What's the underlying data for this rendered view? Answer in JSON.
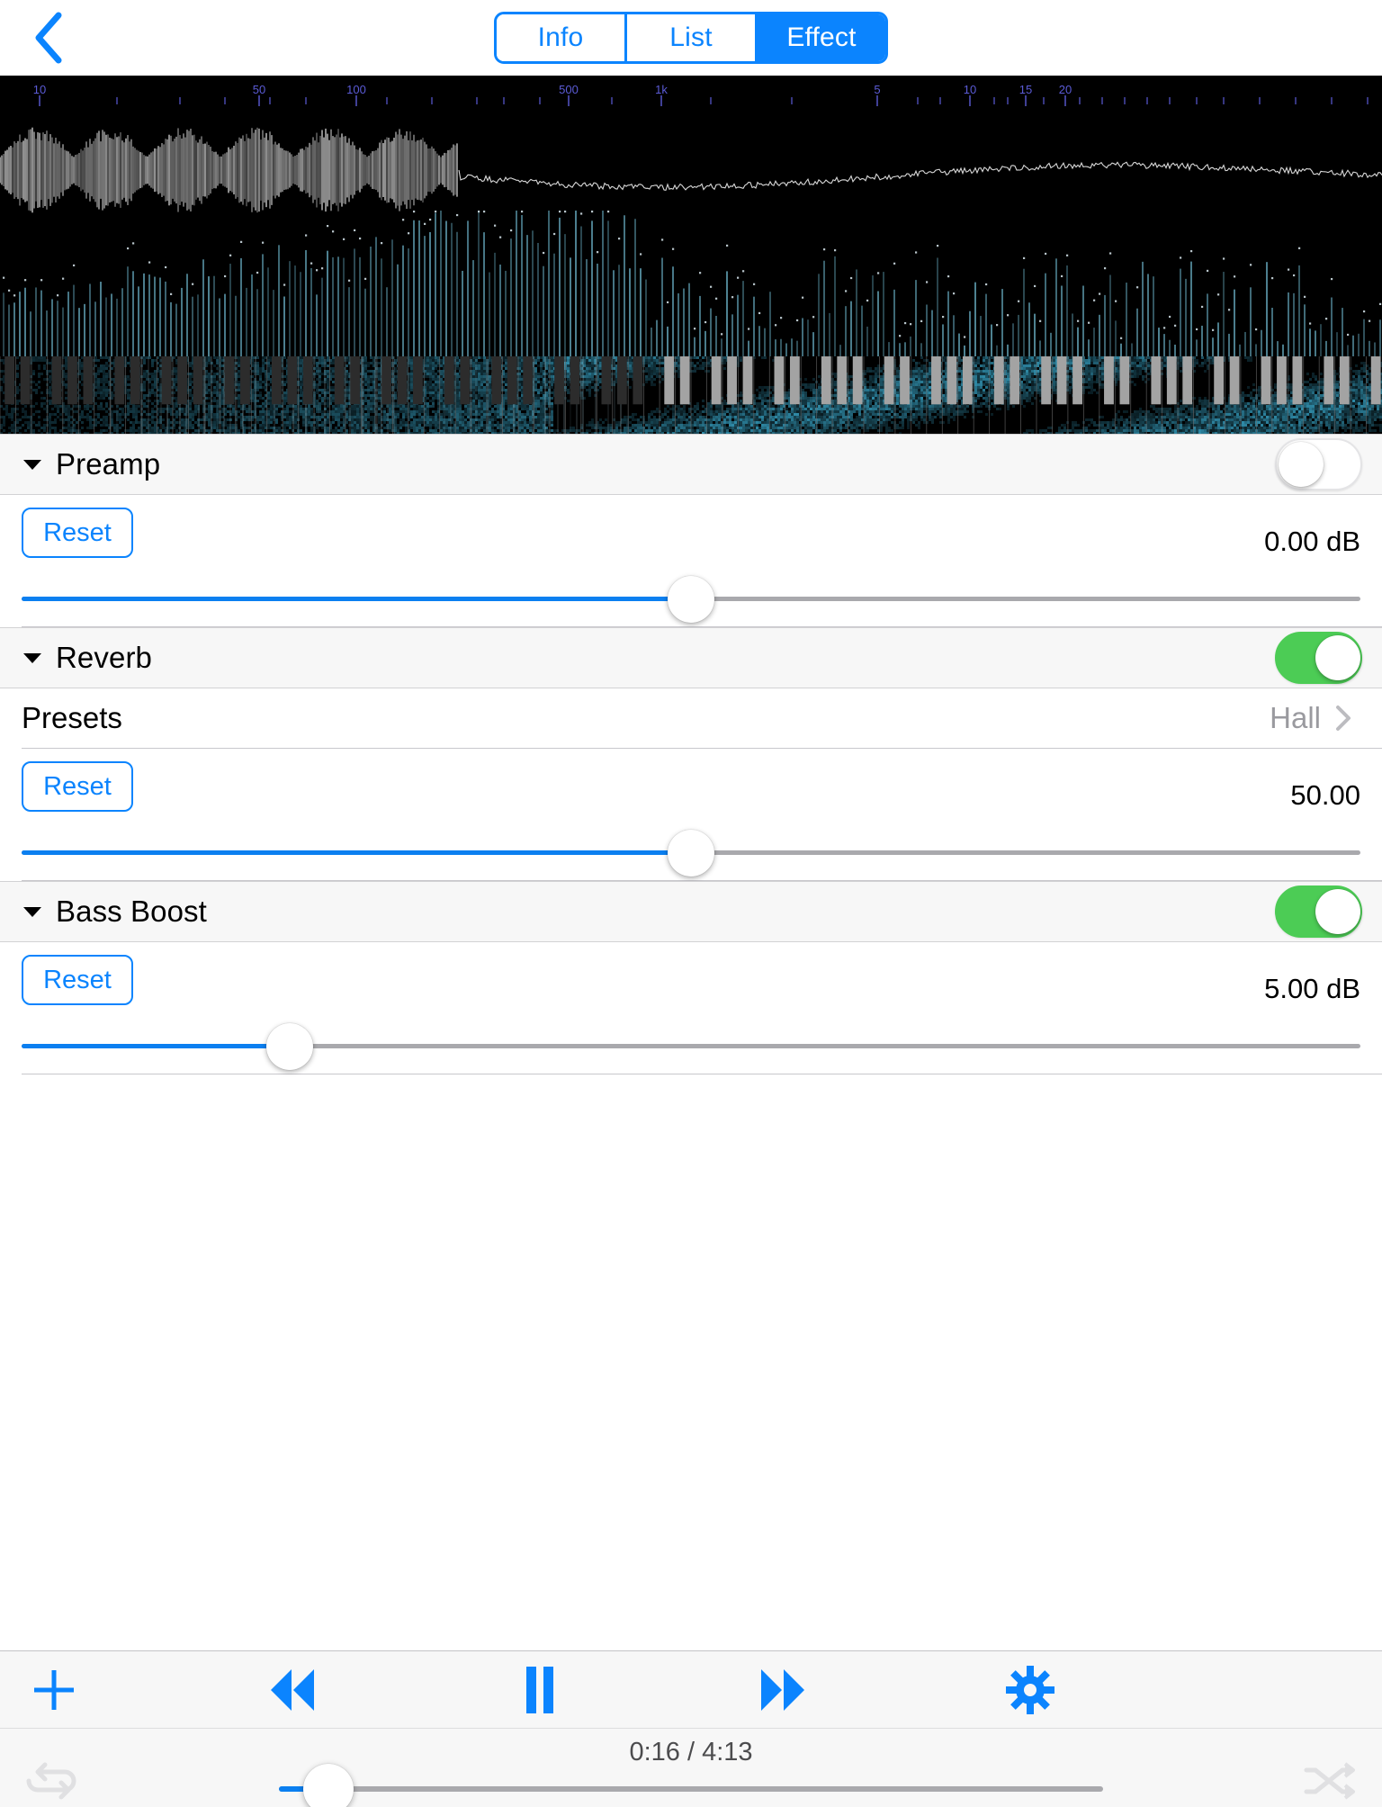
{
  "nav": {
    "back_icon": "chevron-left-icon",
    "segments": [
      {
        "label": "Info",
        "active": false
      },
      {
        "label": "List",
        "active": false
      },
      {
        "label": "Effect",
        "active": true
      }
    ]
  },
  "visualizer": {
    "background_color": "#000000",
    "waveform_color": "#b4b4b4",
    "spectrum_color": "#6fb8cf",
    "spectrogram_color": "#2f8ba8",
    "scale_tick_color": "#5b5bd6",
    "frequency_ticks": [
      "10",
      "50",
      "100",
      "500",
      "1k",
      "5",
      "10",
      "15",
      "20"
    ],
    "keyboard": {
      "white_key_color": "#9b9b9b",
      "black_key_color": "#3d3d3d"
    }
  },
  "effects": [
    {
      "name": "Preamp",
      "enabled": false,
      "reset_label": "Reset",
      "value_label": "0.00 dB",
      "slider_percent": 50,
      "has_presets": false
    },
    {
      "name": "Reverb",
      "enabled": true,
      "reset_label": "Reset",
      "value_label": "50.00",
      "slider_percent": 50,
      "has_presets": true,
      "presets_label": "Presets",
      "presets_value": "Hall"
    },
    {
      "name": "Bass Boost",
      "enabled": true,
      "reset_label": "Reset",
      "value_label": "5.00 dB",
      "slider_percent": 20,
      "has_presets": false
    }
  ],
  "transport": {
    "add_icon": "plus-icon",
    "rewind_icon": "rewind-icon",
    "play_pause_icon": "pause-icon",
    "forward_icon": "fast-forward-icon",
    "settings_icon": "gear-icon",
    "repeat_icon": "repeat-icon",
    "shuffle_icon": "shuffle-icon",
    "time_text": "0:16 / 4:13",
    "elapsed": "0:16",
    "duration": "4:13",
    "progress_percent": 6,
    "accent_color": "#0b84fe",
    "inactive_icon_color": "#e3e3e5"
  },
  "colors": {
    "accent_blue": "#0b84fe",
    "toggle_on_green": "#4ccc55",
    "section_header_bg": "#f7f7f7",
    "slider_track": "#a9a9ad",
    "slider_fill": "#0b7ff0",
    "secondary_text": "#9a9a9f"
  }
}
